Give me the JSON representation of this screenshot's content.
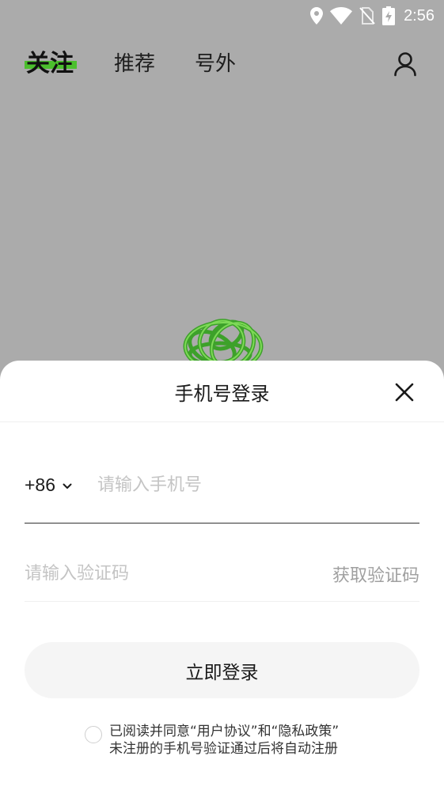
{
  "status_bar": {
    "time": "2:56",
    "icons": [
      "location-icon",
      "wifi-icon",
      "no-sim-icon",
      "battery-charging-icon"
    ]
  },
  "nav": {
    "tabs": [
      {
        "label": "关注",
        "active": true
      },
      {
        "label": "推荐",
        "active": false
      },
      {
        "label": "号外",
        "active": false
      }
    ],
    "profile_icon": "user-icon"
  },
  "login_sheet": {
    "title": "手机号登录",
    "close_icon": "close-icon",
    "country_code": "+86",
    "phone_placeholder": "请输入手机号",
    "code_placeholder": "请输入验证码",
    "get_code_label": "获取验证码",
    "login_button_label": "立即登录",
    "agreement": {
      "prefix": "已阅读并同意",
      "user_agreement": "“用户协议”",
      "and": "和",
      "privacy_policy": "“隐私政策”",
      "note": "未注册的手机号验证通过后将自动注册"
    }
  },
  "colors": {
    "accent_green": "#4bbf2d",
    "overlay_gray": "#ababab",
    "sheet_bg": "#ffffff",
    "button_bg": "#f5f5f5",
    "placeholder": "#c4c4c4"
  }
}
